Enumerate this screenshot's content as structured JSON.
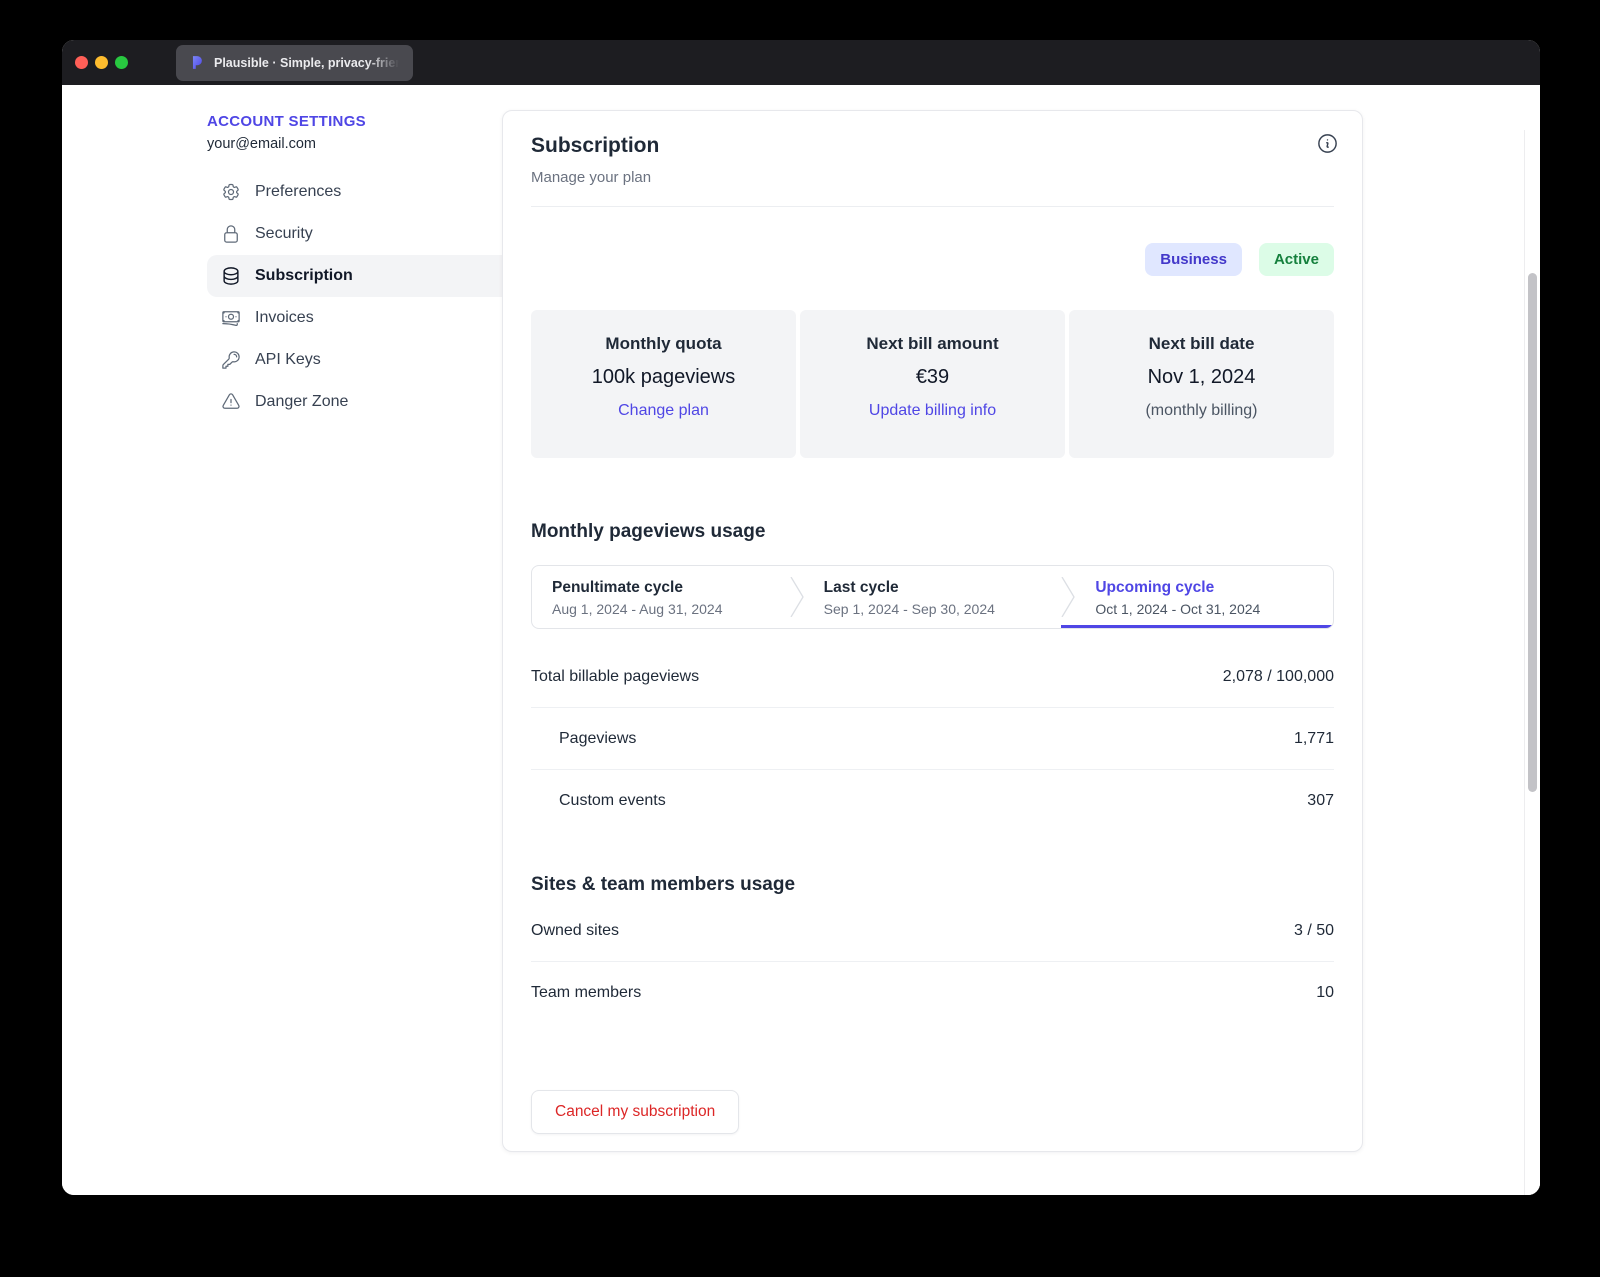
{
  "window": {
    "tab_title": "Plausible · Simple, privacy-frien"
  },
  "sidebar": {
    "title": "ACCOUNT SETTINGS",
    "email": "your@email.com",
    "items": [
      {
        "label": "Preferences",
        "icon": "gear-icon",
        "active": false
      },
      {
        "label": "Security",
        "icon": "lock-icon",
        "active": false
      },
      {
        "label": "Subscription",
        "icon": "database-icon",
        "active": true
      },
      {
        "label": "Invoices",
        "icon": "banknote-icon",
        "active": false
      },
      {
        "label": "API Keys",
        "icon": "key-icon",
        "active": false
      },
      {
        "label": "Danger Zone",
        "icon": "warning-triangle-icon",
        "active": false
      }
    ]
  },
  "subscription": {
    "title": "Subscription",
    "subtitle": "Manage your plan",
    "plan_badge": "Business",
    "status_badge": "Active",
    "stats": [
      {
        "label": "Monthly quota",
        "value": "100k pageviews",
        "link": "Change plan"
      },
      {
        "label": "Next bill amount",
        "value": "€39",
        "link": "Update billing info"
      },
      {
        "label": "Next bill date",
        "value": "Nov 1, 2024",
        "note": "(monthly billing)"
      }
    ],
    "pageviews": {
      "heading": "Monthly pageviews usage",
      "cycles": [
        {
          "label": "Penultimate cycle",
          "range": "Aug 1, 2024 - Aug 31, 2024",
          "active": false
        },
        {
          "label": "Last cycle",
          "range": "Sep 1, 2024 - Sep 30, 2024",
          "active": false
        },
        {
          "label": "Upcoming cycle",
          "range": "Oct 1, 2024 - Oct 31, 2024",
          "active": true
        }
      ],
      "rows": [
        {
          "label": "Total billable pageviews",
          "value": "2,078 / 100,000"
        },
        {
          "label": "Pageviews",
          "value": "1,771"
        },
        {
          "label": "Custom events",
          "value": "307"
        }
      ]
    },
    "sites": {
      "heading": "Sites & team members usage",
      "rows": [
        {
          "label": "Owned sites",
          "value": "3 / 50"
        },
        {
          "label": "Team members",
          "value": "10"
        }
      ]
    },
    "cancel_button": "Cancel my subscription"
  },
  "colors": {
    "accent_indigo": "#4f46e5",
    "plan_badge_bg": "#e0e7ff",
    "plan_badge_text": "#4338ca",
    "status_badge_bg": "#dcfce7",
    "status_badge_text": "#15803d",
    "danger_red": "#dc2626",
    "titlebar_bg": "#1d1d21",
    "stat_box_bg": "#f3f4f6"
  }
}
